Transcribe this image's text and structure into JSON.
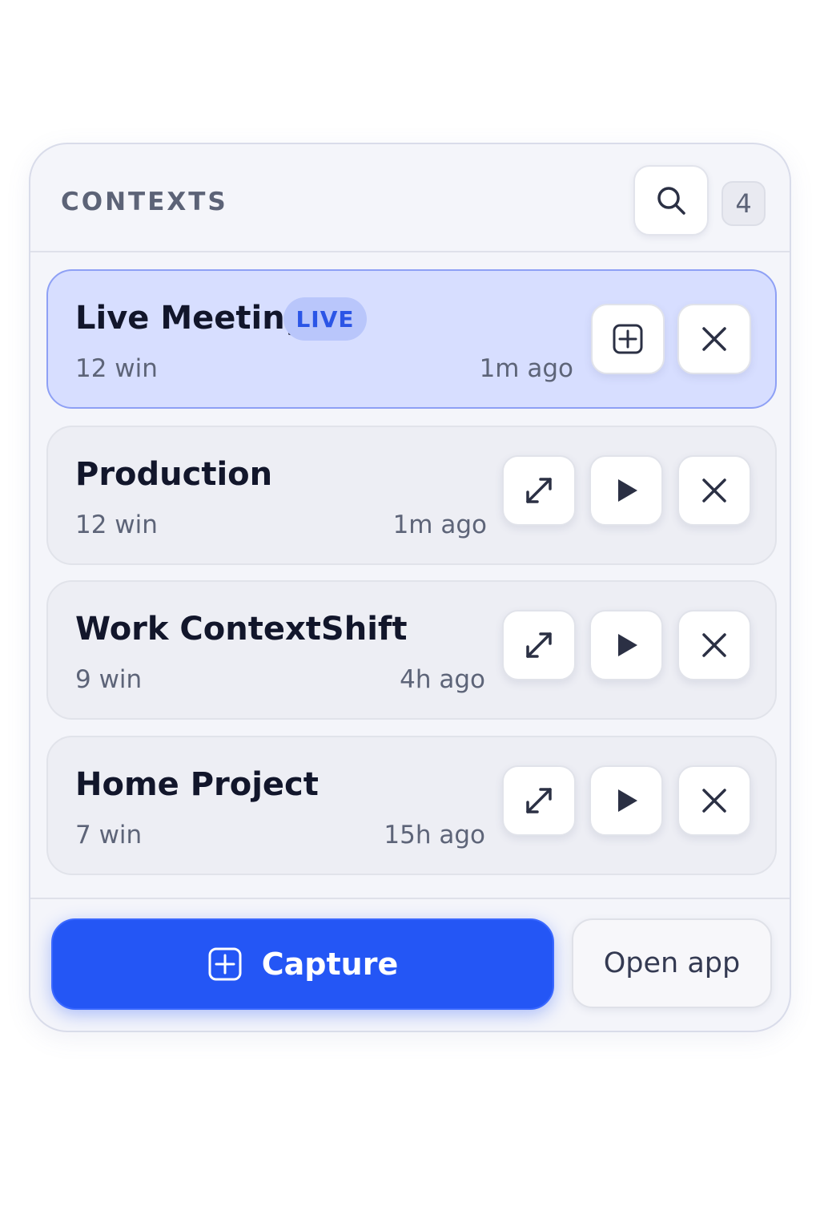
{
  "header": {
    "title": "CONTEXTS",
    "count": "4",
    "search_icon": "search-icon"
  },
  "contexts": [
    {
      "name": "Live Meeting",
      "badge": "LIVE",
      "windows": "12 win",
      "time": "1m ago",
      "actions": [
        "add-icon",
        "close-icon"
      ]
    },
    {
      "name": "Production",
      "windows": "12 win",
      "time": "1m ago",
      "actions": [
        "expand-icon",
        "play-icon",
        "close-icon"
      ]
    },
    {
      "name": "Work ContextShift",
      "windows": "9 win",
      "time": "4h ago",
      "actions": [
        "expand-icon",
        "play-icon",
        "close-icon"
      ]
    },
    {
      "name": "Home Project",
      "windows": "7 win",
      "time": "15h ago",
      "actions": [
        "expand-icon",
        "play-icon",
        "close-icon"
      ]
    }
  ],
  "footer": {
    "capture_label": "Capture",
    "open_app_label": "Open app"
  },
  "colors": {
    "accent": "#2456f5",
    "live_card_bg": "#d7deff",
    "live_badge_text": "#2b55e6"
  }
}
